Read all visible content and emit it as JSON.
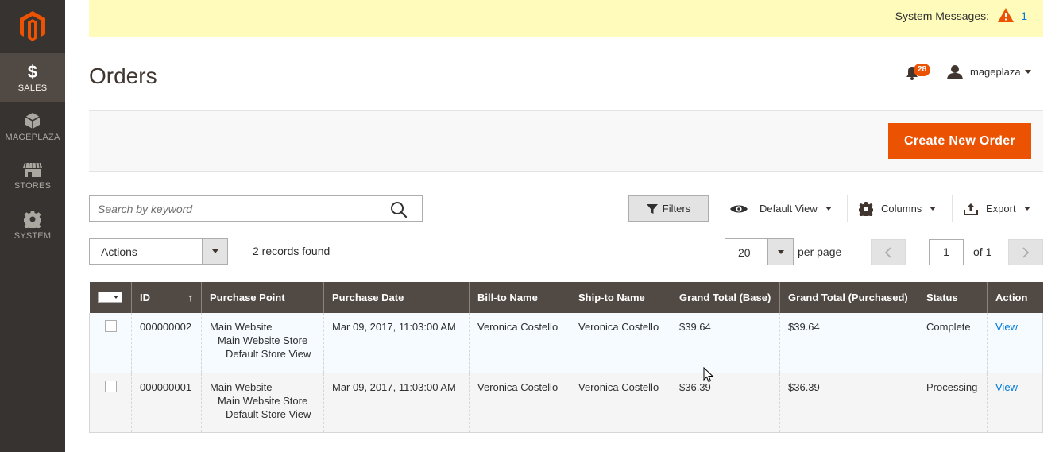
{
  "sidebar": {
    "items": [
      {
        "label": "SALES",
        "icon": "dollar-icon",
        "glyph": "$"
      },
      {
        "label": "MAGEPLAZA",
        "icon": "cube-icon"
      },
      {
        "label": "STORES",
        "icon": "store-icon"
      },
      {
        "label": "SYSTEM",
        "icon": "gear-icon"
      }
    ]
  },
  "system_messages": {
    "label": "System Messages:",
    "count": "1"
  },
  "header": {
    "title": "Orders",
    "notification_count": "28",
    "username": "mageplaza"
  },
  "actionbar": {
    "create_label": "Create New Order"
  },
  "toolbar": {
    "search_placeholder": "Search by keyword",
    "filters_label": "Filters",
    "view_label": "Default View",
    "columns_label": "Columns",
    "export_label": "Export",
    "actions_label": "Actions",
    "records_found": "2 records found",
    "per_page_value": "20",
    "per_page_label": "per page",
    "page_value": "1",
    "page_of": "of 1"
  },
  "grid": {
    "columns": [
      "ID",
      "Purchase Point",
      "Purchase Date",
      "Bill-to Name",
      "Ship-to Name",
      "Grand Total (Base)",
      "Grand Total (Purchased)",
      "Status",
      "Action"
    ],
    "sort_indicator": "↑",
    "rows": [
      {
        "id": "000000002",
        "purchase_point": [
          "Main Website",
          "Main Website Store",
          "Default Store View"
        ],
        "purchase_date": "Mar 09, 2017, 11:03:00 AM",
        "bill_to": "Veronica Costello",
        "ship_to": "Veronica Costello",
        "total_base": "$39.64",
        "total_purchased": "$39.64",
        "status": "Complete",
        "action": "View"
      },
      {
        "id": "000000001",
        "purchase_point": [
          "Main Website",
          "Main Website Store",
          "Default Store View"
        ],
        "purchase_date": "Mar 09, 2017, 11:03:00 AM",
        "bill_to": "Veronica Costello",
        "ship_to": "Veronica Costello",
        "total_base": "$36.39",
        "total_purchased": "$36.39",
        "status": "Processing",
        "action": "View"
      }
    ]
  },
  "colors": {
    "accent": "#eb5202",
    "sidebar": "#373330",
    "header_row": "#514943",
    "link": "#007bdb"
  }
}
